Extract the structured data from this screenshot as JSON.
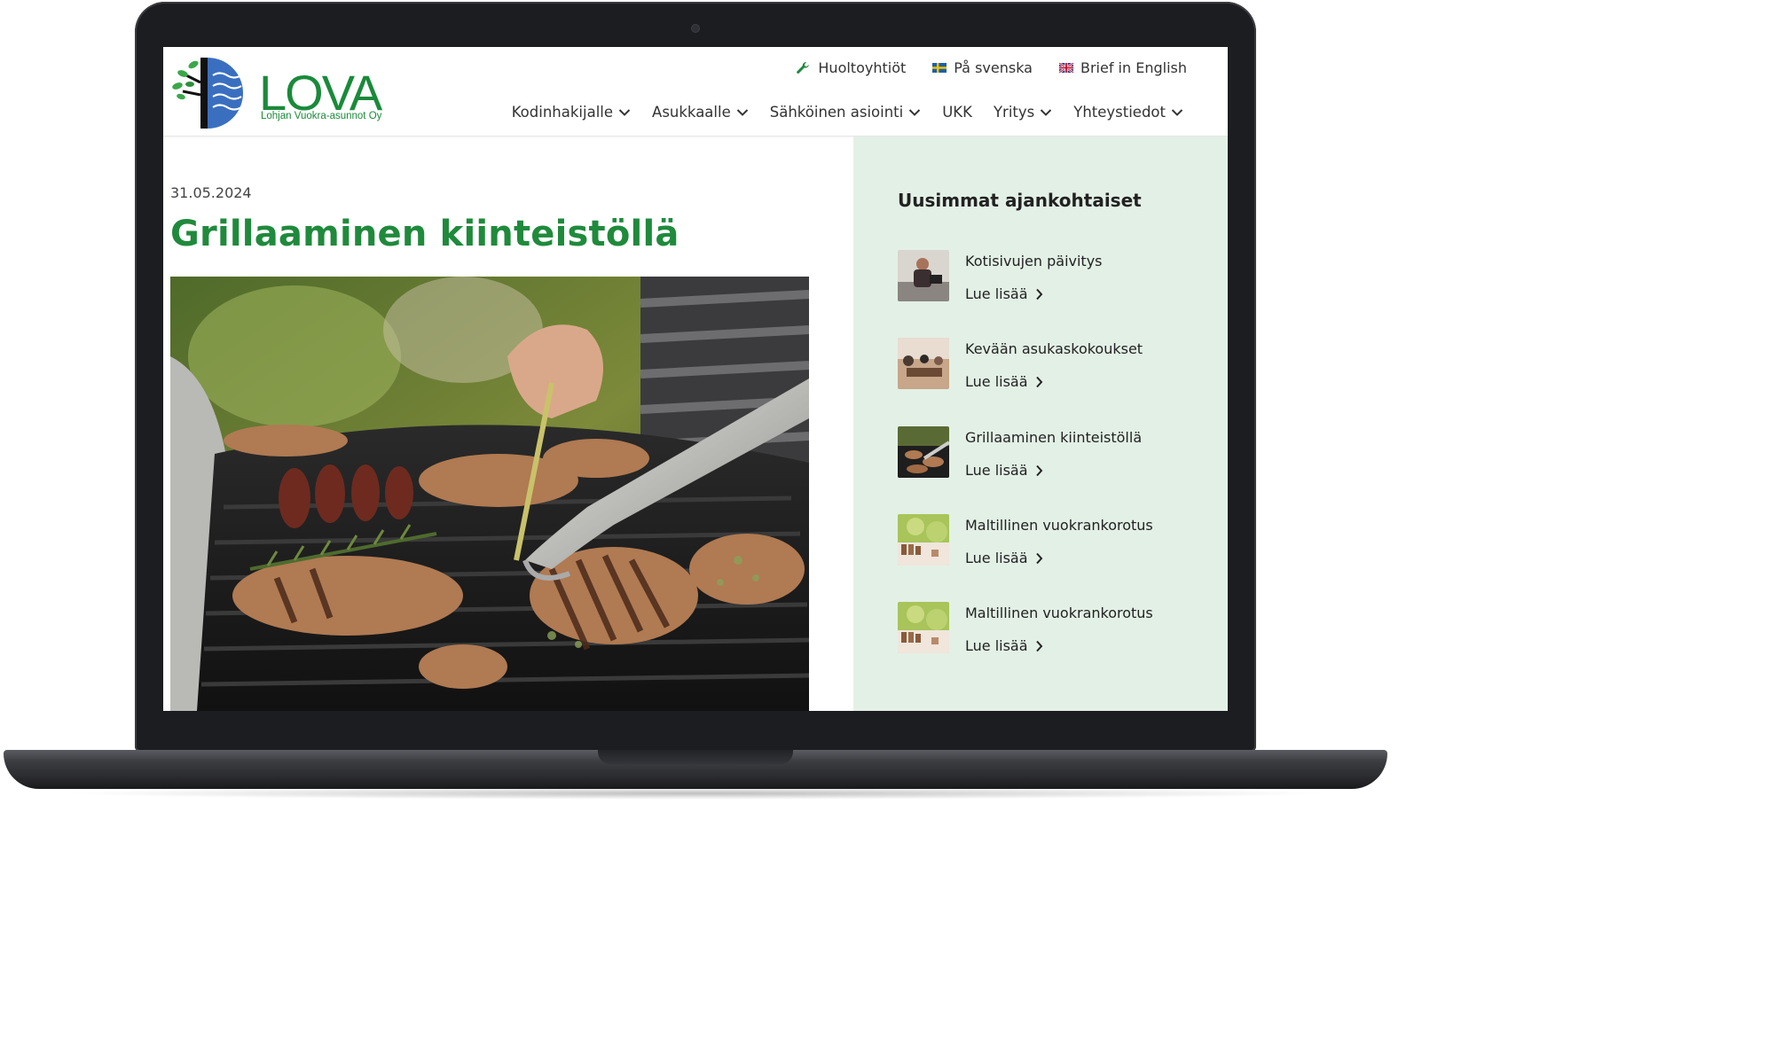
{
  "site": {
    "logo_text": "LOVA",
    "logo_subtitle": "Lohjan Vuokra-asunnot Oy"
  },
  "top_links": [
    {
      "label": "Huoltoyhtiöt",
      "icon": "wrench-icon"
    },
    {
      "label": "På svenska",
      "icon": "swedish-flag-icon"
    },
    {
      "label": "Brief in English",
      "icon": "uk-flag-icon"
    }
  ],
  "nav": [
    {
      "label": "Kodinhakijalle",
      "dropdown": true
    },
    {
      "label": "Asukkaalle",
      "dropdown": true
    },
    {
      "label": "Sähköinen asiointi",
      "dropdown": true
    },
    {
      "label": "UKK",
      "dropdown": false
    },
    {
      "label": "Yritys",
      "dropdown": true
    },
    {
      "label": "Yhteystiedot",
      "dropdown": true
    }
  ],
  "article": {
    "date": "31.05.2024",
    "title": "Grillaaminen kiinteistöllä",
    "image": "grill-photo"
  },
  "sidebar": {
    "title": "Uusimmat ajankohtaiset",
    "read_more_label": "Lue lisää",
    "items": [
      {
        "title": "Kotisivujen päivitys",
        "thumb": "person-at-laptop"
      },
      {
        "title": "Kevään asukaskokoukset",
        "thumb": "meeting"
      },
      {
        "title": "Grillaaminen kiinteistöllä",
        "thumb": "grill"
      },
      {
        "title": "Maltillinen vuokrankorotus",
        "thumb": "coins"
      },
      {
        "title": "Maltillinen vuokrankorotus",
        "thumb": "coins"
      }
    ]
  },
  "colors": {
    "brand_green": "#1f8a3c",
    "sidebar_bg": "#e3f0e6",
    "logo_blue": "#3a6fc0"
  }
}
